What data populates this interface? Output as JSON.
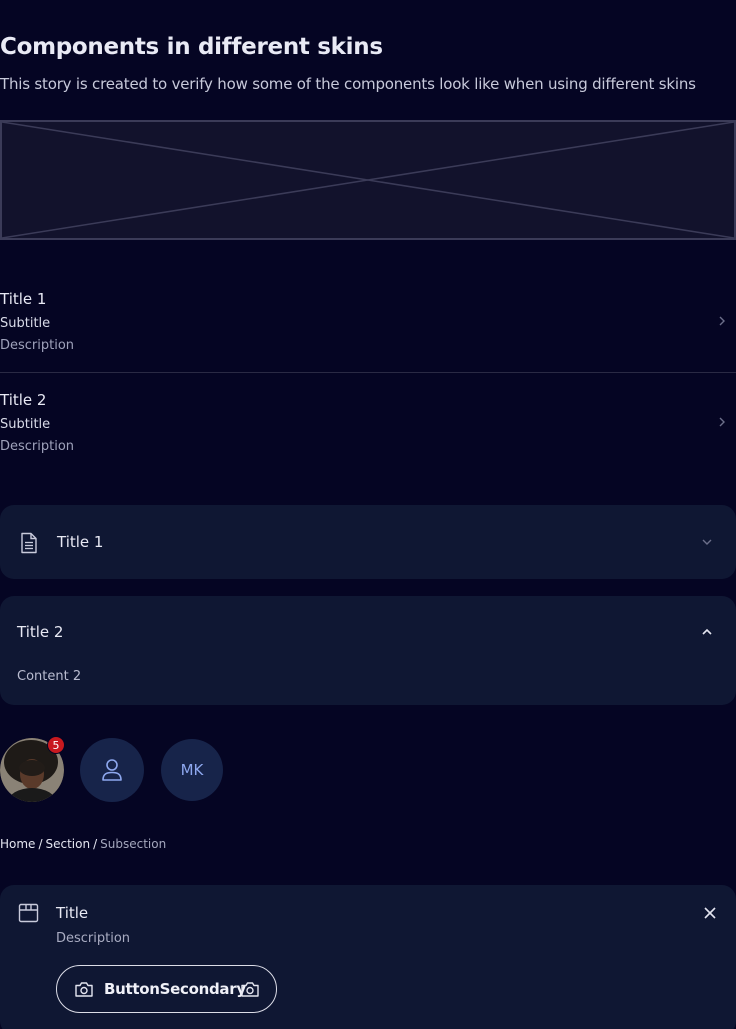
{
  "header": {
    "title": "Components in different skins",
    "subtitle": "This story is created to verify how some of the components look like when using different skins"
  },
  "list": {
    "items": [
      {
        "title": "Title 1",
        "subtitle": "Subtitle",
        "description": "Description",
        "icon": "chevron-right-icon"
      },
      {
        "title": "Title 2",
        "subtitle": "Subtitle",
        "description": "Description",
        "icon": "chevron-right-icon"
      }
    ]
  },
  "accordion": {
    "items": [
      {
        "title": "Title 1",
        "icon": "document-icon",
        "expanded": false
      },
      {
        "title": "Title 2",
        "content": "Content 2",
        "expanded": true
      }
    ]
  },
  "avatars": {
    "badge_count": "5",
    "initials": "MK",
    "icons": [
      "photo-avatar",
      "user-icon"
    ]
  },
  "breadcrumb": {
    "items": [
      "Home",
      "Section",
      "Subsection"
    ],
    "separator": "/"
  },
  "callout": {
    "title": "Title",
    "description": "Description",
    "button_label": "ButtonSecondary",
    "icons": [
      "box-icon",
      "close-icon",
      "camera-icon"
    ]
  },
  "colors": {
    "background": "#050523",
    "surface": "#0f1733",
    "badge": "#c8191f",
    "avatar_bg": "#17244a",
    "avatar_text": "#8ea8ef"
  }
}
